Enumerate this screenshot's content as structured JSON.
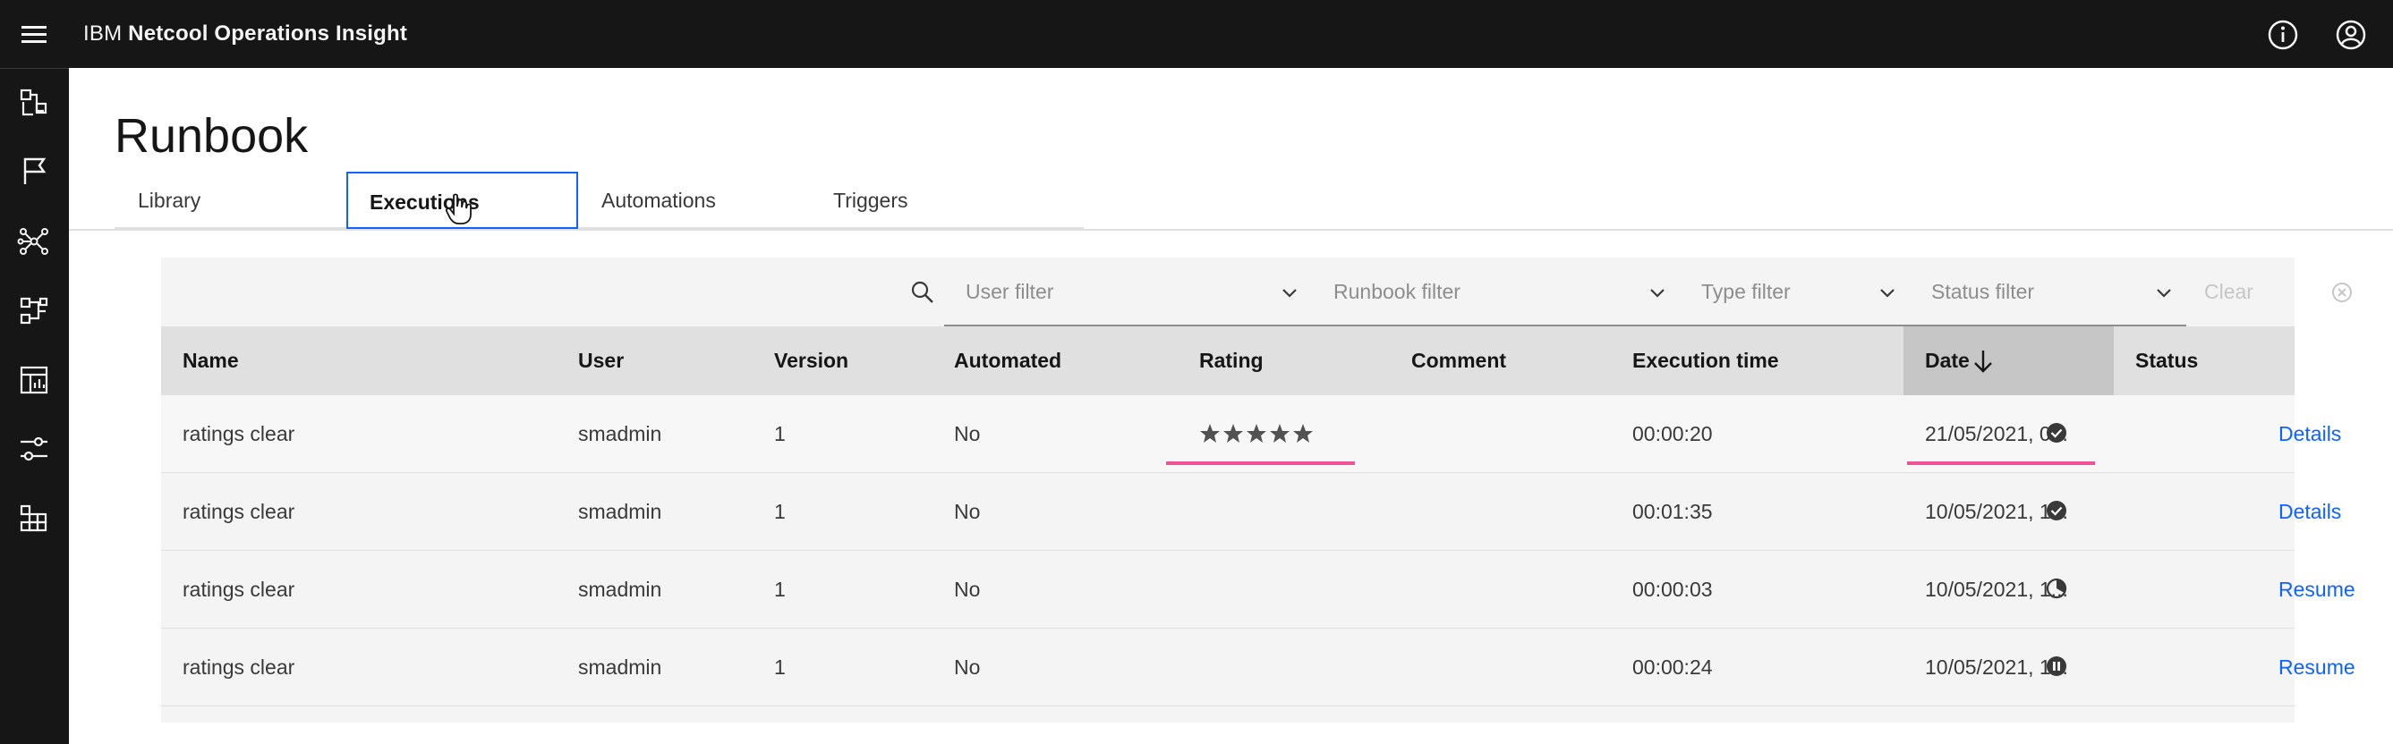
{
  "header": {
    "brand_prefix": "IBM",
    "brand_product": "Netcool Operations Insight",
    "icons": [
      "menu-icon",
      "info-icon",
      "user-avatar-icon"
    ]
  },
  "sidebar": {
    "icons": [
      "incidents-icon",
      "flag-icon",
      "topology-icon",
      "runbook-icon",
      "dashboard-icon",
      "settings-sliders-icon",
      "applications-icon"
    ]
  },
  "page": {
    "title": "Runbook"
  },
  "tabs": [
    {
      "label": "Library",
      "active": false
    },
    {
      "label": "Executions",
      "active": true
    },
    {
      "label": "Automations",
      "active": false
    },
    {
      "label": "Triggers",
      "active": false
    }
  ],
  "filters": {
    "user_placeholder": "User filter",
    "runbook_placeholder": "Runbook filter",
    "type_placeholder": "Type filter",
    "status_placeholder": "Status filter",
    "clear_label": "Clear filters"
  },
  "table": {
    "columns": [
      "Name",
      "User",
      "Version",
      "Automated",
      "Rating",
      "Comment",
      "Execution time",
      "Date",
      "Status"
    ],
    "sort_column": "Date",
    "sort_direction": "descending",
    "rows": [
      {
        "name": "ratings clear",
        "user": "smadmin",
        "version": "1",
        "automated": "No",
        "rating": 5,
        "comment": "",
        "execution_time": "00:00:20",
        "date": "21/05/2021, 0...",
        "status": "complete",
        "action": "Details"
      },
      {
        "name": "ratings clear",
        "user": "smadmin",
        "version": "1",
        "automated": "No",
        "rating": 0,
        "comment": "",
        "execution_time": "00:01:35",
        "date": "10/05/2021, 1...",
        "status": "complete",
        "action": "Details"
      },
      {
        "name": "ratings clear",
        "user": "smadmin",
        "version": "1",
        "automated": "No",
        "rating": 0,
        "comment": "",
        "execution_time": "00:00:03",
        "date": "10/05/2021, 1...",
        "status": "in-progress",
        "action": "Resume"
      },
      {
        "name": "ratings clear",
        "user": "smadmin",
        "version": "1",
        "automated": "No",
        "rating": 0,
        "comment": "",
        "execution_time": "00:00:24",
        "date": "10/05/2021, 1...",
        "status": "paused",
        "action": "Resume"
      }
    ]
  },
  "colors": {
    "header_bg": "#161616",
    "accent": "#0f62fe",
    "highlight": "#ee5396",
    "table_header_bg": "#e0e0e0",
    "row_bg": "#f4f4f4"
  }
}
